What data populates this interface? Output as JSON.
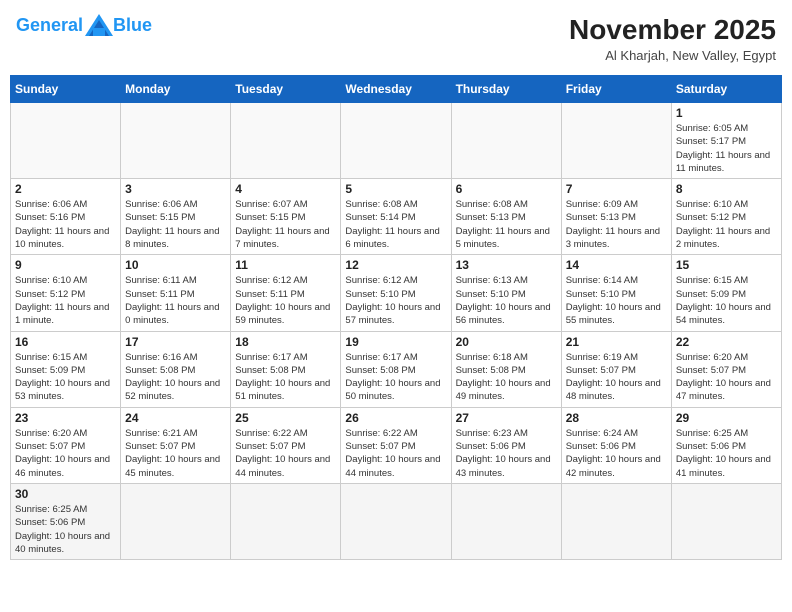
{
  "header": {
    "logo_general": "General",
    "logo_blue": "Blue",
    "title": "November 2025",
    "subtitle": "Al Kharjah, New Valley, Egypt"
  },
  "days": [
    "Sunday",
    "Monday",
    "Tuesday",
    "Wednesday",
    "Thursday",
    "Friday",
    "Saturday"
  ],
  "weeks": [
    [
      {
        "date": "",
        "info": ""
      },
      {
        "date": "",
        "info": ""
      },
      {
        "date": "",
        "info": ""
      },
      {
        "date": "",
        "info": ""
      },
      {
        "date": "",
        "info": ""
      },
      {
        "date": "",
        "info": ""
      },
      {
        "date": "1",
        "info": "Sunrise: 6:05 AM\nSunset: 5:17 PM\nDaylight: 11 hours and 11 minutes."
      }
    ],
    [
      {
        "date": "2",
        "info": "Sunrise: 6:06 AM\nSunset: 5:16 PM\nDaylight: 11 hours and 10 minutes."
      },
      {
        "date": "3",
        "info": "Sunrise: 6:06 AM\nSunset: 5:15 PM\nDaylight: 11 hours and 8 minutes."
      },
      {
        "date": "4",
        "info": "Sunrise: 6:07 AM\nSunset: 5:15 PM\nDaylight: 11 hours and 7 minutes."
      },
      {
        "date": "5",
        "info": "Sunrise: 6:08 AM\nSunset: 5:14 PM\nDaylight: 11 hours and 6 minutes."
      },
      {
        "date": "6",
        "info": "Sunrise: 6:08 AM\nSunset: 5:13 PM\nDaylight: 11 hours and 5 minutes."
      },
      {
        "date": "7",
        "info": "Sunrise: 6:09 AM\nSunset: 5:13 PM\nDaylight: 11 hours and 3 minutes."
      },
      {
        "date": "8",
        "info": "Sunrise: 6:10 AM\nSunset: 5:12 PM\nDaylight: 11 hours and 2 minutes."
      }
    ],
    [
      {
        "date": "9",
        "info": "Sunrise: 6:10 AM\nSunset: 5:12 PM\nDaylight: 11 hours and 1 minute."
      },
      {
        "date": "10",
        "info": "Sunrise: 6:11 AM\nSunset: 5:11 PM\nDaylight: 11 hours and 0 minutes."
      },
      {
        "date": "11",
        "info": "Sunrise: 6:12 AM\nSunset: 5:11 PM\nDaylight: 10 hours and 59 minutes."
      },
      {
        "date": "12",
        "info": "Sunrise: 6:12 AM\nSunset: 5:10 PM\nDaylight: 10 hours and 57 minutes."
      },
      {
        "date": "13",
        "info": "Sunrise: 6:13 AM\nSunset: 5:10 PM\nDaylight: 10 hours and 56 minutes."
      },
      {
        "date": "14",
        "info": "Sunrise: 6:14 AM\nSunset: 5:10 PM\nDaylight: 10 hours and 55 minutes."
      },
      {
        "date": "15",
        "info": "Sunrise: 6:15 AM\nSunset: 5:09 PM\nDaylight: 10 hours and 54 minutes."
      }
    ],
    [
      {
        "date": "16",
        "info": "Sunrise: 6:15 AM\nSunset: 5:09 PM\nDaylight: 10 hours and 53 minutes."
      },
      {
        "date": "17",
        "info": "Sunrise: 6:16 AM\nSunset: 5:08 PM\nDaylight: 10 hours and 52 minutes."
      },
      {
        "date": "18",
        "info": "Sunrise: 6:17 AM\nSunset: 5:08 PM\nDaylight: 10 hours and 51 minutes."
      },
      {
        "date": "19",
        "info": "Sunrise: 6:17 AM\nSunset: 5:08 PM\nDaylight: 10 hours and 50 minutes."
      },
      {
        "date": "20",
        "info": "Sunrise: 6:18 AM\nSunset: 5:08 PM\nDaylight: 10 hours and 49 minutes."
      },
      {
        "date": "21",
        "info": "Sunrise: 6:19 AM\nSunset: 5:07 PM\nDaylight: 10 hours and 48 minutes."
      },
      {
        "date": "22",
        "info": "Sunrise: 6:20 AM\nSunset: 5:07 PM\nDaylight: 10 hours and 47 minutes."
      }
    ],
    [
      {
        "date": "23",
        "info": "Sunrise: 6:20 AM\nSunset: 5:07 PM\nDaylight: 10 hours and 46 minutes."
      },
      {
        "date": "24",
        "info": "Sunrise: 6:21 AM\nSunset: 5:07 PM\nDaylight: 10 hours and 45 minutes."
      },
      {
        "date": "25",
        "info": "Sunrise: 6:22 AM\nSunset: 5:07 PM\nDaylight: 10 hours and 44 minutes."
      },
      {
        "date": "26",
        "info": "Sunrise: 6:22 AM\nSunset: 5:07 PM\nDaylight: 10 hours and 44 minutes."
      },
      {
        "date": "27",
        "info": "Sunrise: 6:23 AM\nSunset: 5:06 PM\nDaylight: 10 hours and 43 minutes."
      },
      {
        "date": "28",
        "info": "Sunrise: 6:24 AM\nSunset: 5:06 PM\nDaylight: 10 hours and 42 minutes."
      },
      {
        "date": "29",
        "info": "Sunrise: 6:25 AM\nSunset: 5:06 PM\nDaylight: 10 hours and 41 minutes."
      }
    ],
    [
      {
        "date": "30",
        "info": "Sunrise: 6:25 AM\nSunset: 5:06 PM\nDaylight: 10 hours and 40 minutes."
      },
      {
        "date": "",
        "info": ""
      },
      {
        "date": "",
        "info": ""
      },
      {
        "date": "",
        "info": ""
      },
      {
        "date": "",
        "info": ""
      },
      {
        "date": "",
        "info": ""
      },
      {
        "date": "",
        "info": ""
      }
    ]
  ]
}
